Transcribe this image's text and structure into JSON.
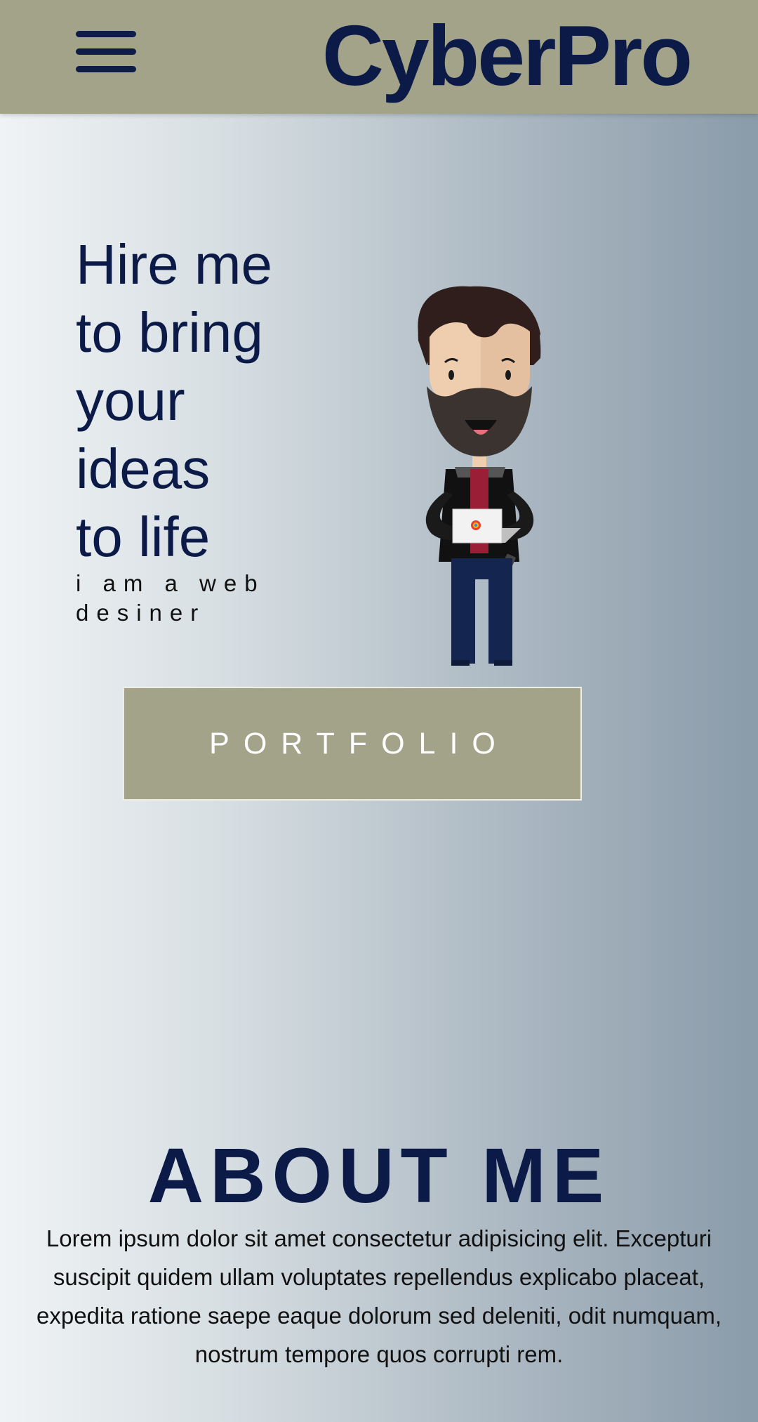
{
  "header": {
    "menu_icon": "hamburger-menu-icon",
    "logo": "CyberPro"
  },
  "hero": {
    "title_lines": [
      "Hire me",
      "to bring",
      "your",
      "ideas",
      "to life"
    ],
    "subtitle": "i am a web desiner",
    "illustration": "cartoon-developer-with-laptop",
    "portfolio_button": "PORTFOLIO"
  },
  "about": {
    "title": "ABOUT ME",
    "text": "Lorem ipsum dolor sit amet consectetur adipisicing elit. Excepturi suscipit quidem ullam voluptates repellendus explicabo placeat, expedita ratione saepe eaque dolorum sed deleniti, odit numquam, nostrum tempore quos corrupti rem."
  },
  "colors": {
    "header_bg": "#a3a38a",
    "primary_text": "#0b1a47",
    "button_bg": "#a3a38a"
  }
}
